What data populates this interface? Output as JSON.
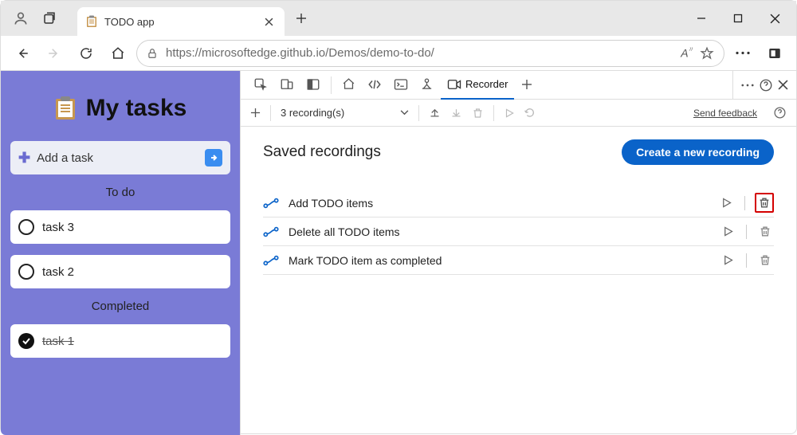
{
  "browser": {
    "tab_title": "TODO app",
    "url_display": "https://microsoftedge.github.io/Demos/demo-to-do/",
    "url_host": "microsoftedge.github.io"
  },
  "app": {
    "title": "My tasks",
    "add_label": "Add a task",
    "sections": {
      "todo": "To do",
      "completed": "Completed"
    },
    "tasks_todo": [
      {
        "label": "task 3"
      },
      {
        "label": "task 2"
      }
    ],
    "tasks_done": [
      {
        "label": "task 1"
      }
    ]
  },
  "devtools": {
    "active_tab": "Recorder",
    "recording_count_label": "3 recording(s)",
    "feedback_label": "Send feedback",
    "heading": "Saved recordings",
    "create_button": "Create a new recording",
    "recordings": [
      {
        "name": "Add TODO items"
      },
      {
        "name": "Delete all TODO items"
      },
      {
        "name": "Mark TODO item as completed"
      }
    ]
  }
}
